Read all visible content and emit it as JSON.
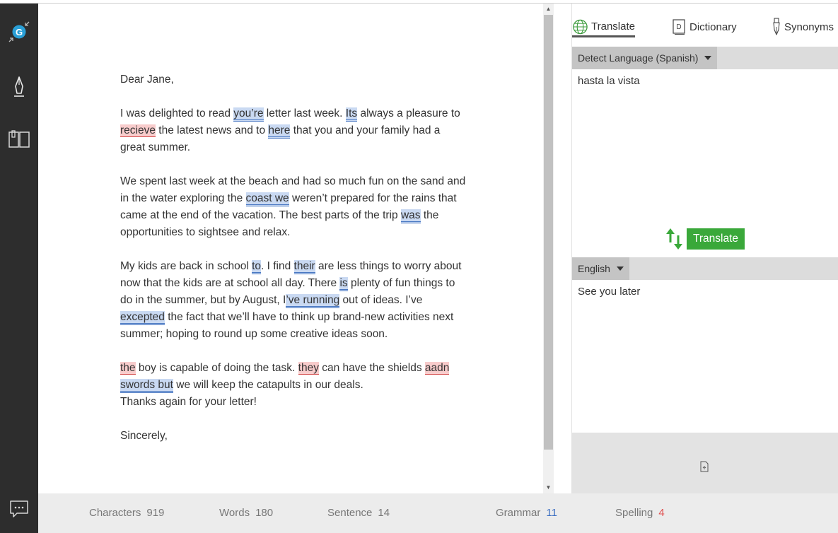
{
  "document": {
    "greeting": "Dear Jane,",
    "p1": {
      "t1": "I was delighted to read ",
      "e1": "you’re",
      "t2": " letter last week. ",
      "e2": "Its",
      "t3": " always a pleasure to ",
      "e3": "recieve",
      "t4": " the latest news and to ",
      "e4": "here",
      "t5": " that you and your family had a great summer."
    },
    "p2": {
      "t1": "We spent last week at the beach and had so much fun on the sand and in the water exploring the ",
      "e1": "coast we",
      "t2": " weren’t prepared for the rains that came at the end of the vacation. The best parts of the trip ",
      "e2": "was",
      "t3": " the opportunities to sightsee and relax."
    },
    "p3": {
      "t1": "My kids are back in school ",
      "e1": "to",
      "t2": ". I find ",
      "e2": "their",
      "t3": " are less things to worry about now that the kids are at school all day.  There ",
      "e3": "is",
      "t4": " plenty of fun things to do in the summer, but by August, I",
      "e4": "’ve running",
      "t5": " out of ideas. I’ve ",
      "e5": "excepted",
      "t6": " the fact that we’ll have to think up brand-new activities next summer; hoping to round up some creative ideas soon."
    },
    "p4": {
      "e1": "the",
      "t1": " boy is capable of doing the task. ",
      "e2": "they",
      "t2": " can have the shields ",
      "e3": "aadn",
      "t3": " ",
      "e4": "swords but",
      "t4": " we will keep the catapults in our deals."
    },
    "thanks": "Thanks again for your letter!",
    "closing": "Sincerely,"
  },
  "panel": {
    "tabs": [
      {
        "label": "Translate",
        "icon": "globe-icon",
        "active": true
      },
      {
        "label": "Dictionary",
        "icon": "dictionary-icon",
        "active": false
      },
      {
        "label": "Synonyms",
        "icon": "pen-nib-icon",
        "active": false
      }
    ],
    "source_language": "Detect Language (Spanish)",
    "source_text": "hasta la vista",
    "translate_label": "Translate",
    "target_language": "English",
    "target_text": "See you later"
  },
  "status": {
    "characters_label": "Characters",
    "characters_value": "919",
    "words_label": "Words",
    "words_value": "180",
    "sentence_label": "Sentence",
    "sentence_value": "14",
    "grammar_label": "Grammar",
    "grammar_value": "11",
    "spelling_label": "Spelling",
    "spelling_value": "4"
  },
  "colors": {
    "rail": "#2d2d2d",
    "logo": "#2a9fd6",
    "grammar_highlight": "#c9d9f2",
    "spelling_highlight": "#f8cccc",
    "translate_button": "#3aa83a",
    "grammar_count": "#3c6fc2",
    "spelling_count": "#e05151"
  }
}
